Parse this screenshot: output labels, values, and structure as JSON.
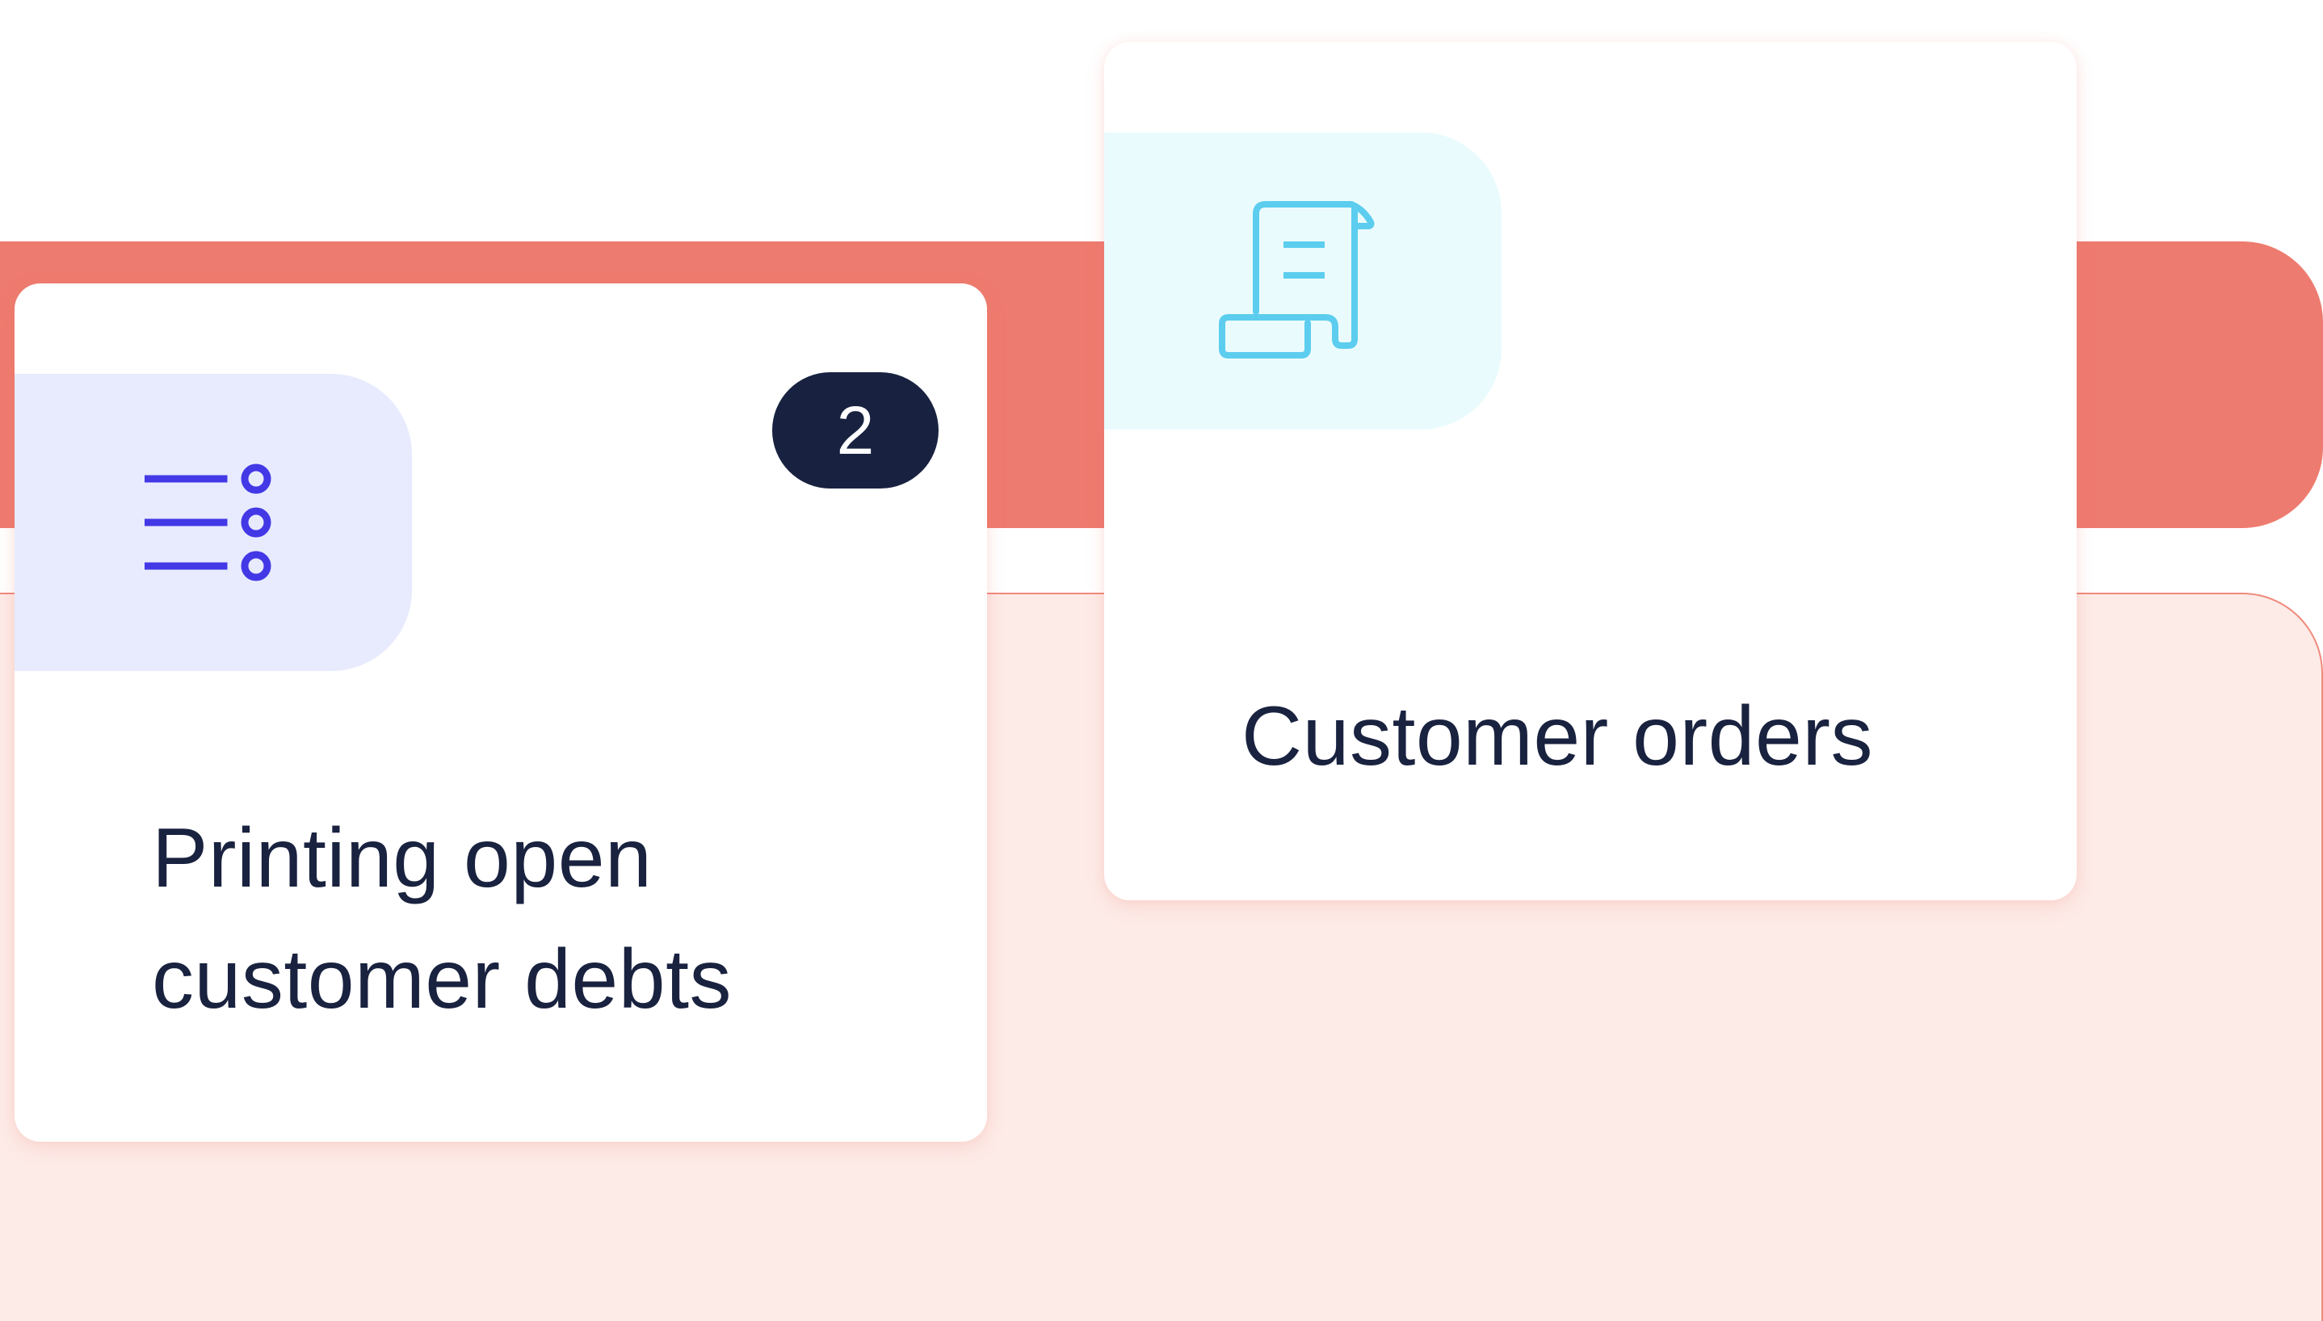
{
  "cards": [
    {
      "title": "Printing open\ncustomer debts",
      "icon": "list-options-icon",
      "badge": "2",
      "icon_color": "#4338e6",
      "tile_color": "#e7ebfd"
    },
    {
      "title": "Customer orders",
      "icon": "receipt-scroll-icon",
      "icon_color": "#5ccdee",
      "tile_color": "#eafbfd"
    }
  ],
  "colors": {
    "accent_band": "#ee7b6f",
    "panel_background": "#fdebe7",
    "badge_background": "#182240",
    "text": "#19223f"
  }
}
